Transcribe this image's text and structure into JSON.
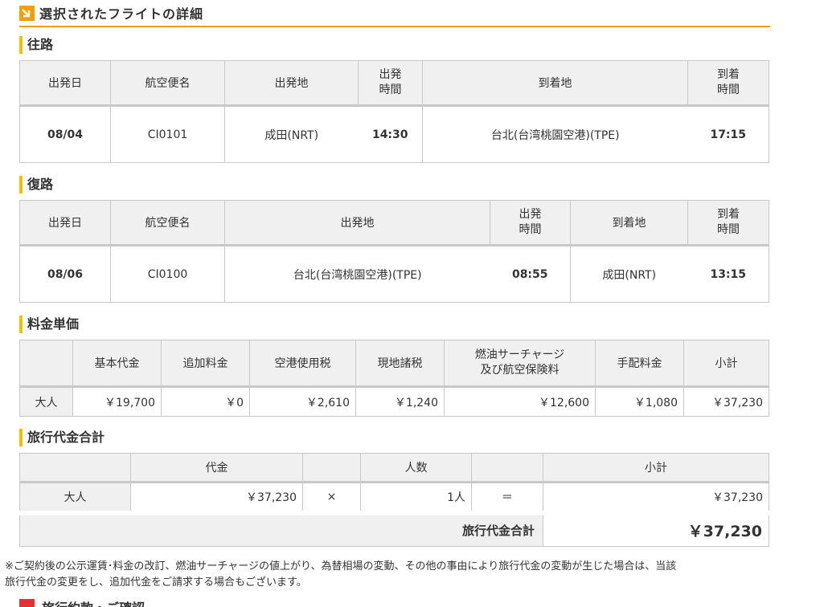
{
  "page_title": "選択されたフライトの詳細",
  "outbound": {
    "section_title": "往路",
    "headers": {
      "date": "出発日",
      "flight": "航空便名",
      "from": "出発地",
      "dep_time_1": "出発",
      "dep_time_2": "時間",
      "to": "到着地",
      "arr_time_1": "到着",
      "arr_time_2": "時間"
    },
    "row": {
      "date": "08/04",
      "flight": "CI0101",
      "from": "成田(NRT)",
      "dep_time": "14:30",
      "to": "台北(台湾桃園空港)(TPE)",
      "arr_time": "17:15"
    }
  },
  "return": {
    "section_title": "復路",
    "headers": {
      "date": "出発日",
      "flight": "航空便名",
      "from": "出発地",
      "dep_time_1": "出発",
      "dep_time_2": "時間",
      "to": "到着地",
      "arr_time_1": "到着",
      "arr_time_2": "時間"
    },
    "row": {
      "date": "08/06",
      "flight": "CI0100",
      "from": "台北(台湾桃園空港)(TPE)",
      "dep_time": "08:55",
      "to": "成田(NRT)",
      "arr_time": "13:15"
    }
  },
  "unit_price": {
    "section_title": "料金単価",
    "headers": {
      "base": "基本代金",
      "extra": "追加料金",
      "airport_tax": "空港使用税",
      "local_tax": "現地諸税",
      "fuel_1": "燃油サーチャージ",
      "fuel_2": "及び航空保険料",
      "handling": "手配料金",
      "subtotal": "小計"
    },
    "row": {
      "label": "大人",
      "base": "￥19,700",
      "extra": "￥0",
      "airport_tax": "￥2,610",
      "local_tax": "￥1,240",
      "fuel": "￥12,600",
      "handling": "￥1,080",
      "subtotal": "￥37,230"
    }
  },
  "total": {
    "section_title": "旅行代金合計",
    "headers": {
      "price": "代金",
      "people": "人数",
      "subtotal": "小計"
    },
    "row": {
      "label": "大人",
      "price": "￥37,230",
      "times": "×",
      "people": "1人",
      "equals": "＝",
      "subtotal": "￥37,230"
    },
    "grand_label": "旅行代金合計",
    "grand_value": "￥37,230"
  },
  "note_line1": "※ご契約後の公示運賃･料金の改訂、燃油サーチャージの値上がり、為替相場の変動、その他の事由により旅行代金の変動が生じた場合は、当該",
  "note_line2": "旅行代金の変更をし、追加代金をご請求する場合もございます。",
  "next_section_partial": "旅行約款・ご確認"
}
